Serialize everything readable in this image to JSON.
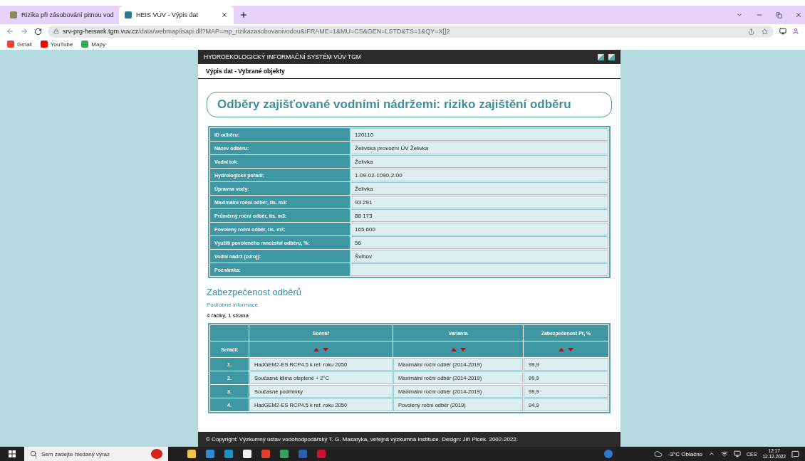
{
  "browser": {
    "tabs": [
      {
        "title": "Rizika při zásobování pitnou vod",
        "selected": false
      },
      {
        "title": "HEIS VÚV - Výpis dat",
        "selected": true
      }
    ],
    "url_host": "srv-prg-heiswrk.tgm.vuv.cz",
    "url_path": "/data/webmap/isapi.dll?MAP=mp_rizikazasobovanivodou&IFRAME=1&MU=CS&GEN=LSTD&TS=1&QY=X[]2",
    "bookmarks": [
      "Gmail",
      "YouTube",
      "Mapy"
    ]
  },
  "page": {
    "header": "HYDROEKOLOGICKÝ INFORMAČNÍ SYSTÉM VÚV TGM",
    "subtitle": "Výpis dat - Vybrané objekty",
    "title": "Odběry zajišťované vodními nádržemi: riziko zajištění odběru",
    "details": [
      {
        "label": "ID odběru:",
        "value": "120110"
      },
      {
        "label": "Název odběru:",
        "value": "Želivská provozní ÚV Želivka"
      },
      {
        "label": "Vodní tok:",
        "value": "Želivka"
      },
      {
        "label": "Hydrologické pořadí:",
        "value": "1-09-02-1090-2-00"
      },
      {
        "label": "Úpravna vody:",
        "value": "Želivka"
      },
      {
        "label": "Maximální roční odběr, tis. m3:",
        "value": "93 291"
      },
      {
        "label": "Průměrný roční odběr, tis. m3:",
        "value": "88 173"
      },
      {
        "label": "Povolený roční odběr, tis. m3:",
        "value": "165 600"
      },
      {
        "label": "Využití povoleného množství odběru, %:",
        "value": "56"
      },
      {
        "label": "Vodní nádrž (zdroj):",
        "value": "Švihov"
      },
      {
        "label": "Poznámka:"
      }
    ],
    "section_title": "Zabezpečenost odběrů",
    "details_link": "Podrobné informace",
    "count": "4 řádky, 1 strana",
    "table": {
      "sort_label": "Seřadit",
      "columns": [
        "Scénář",
        "Varianta",
        "Zabezpečenost Pt, %"
      ],
      "rows": [
        {
          "index": "1.",
          "cells": [
            "HadGEM2-ES RCP4.5 k ref. roku 2050",
            "Maximální roční odběr (2014-2019)",
            "99,9"
          ]
        },
        {
          "index": "2.",
          "cells": [
            "Současné klima oteplené + 2°C",
            "Maximální roční odběr (2014-2019)",
            "99,9"
          ]
        },
        {
          "index": "3.",
          "cells": [
            "Současné podmínky",
            "Maximální roční odběr (2014-2019)",
            "99,9"
          ]
        },
        {
          "index": "4.",
          "cells": [
            "HadGEM2-ES RCP4.5 k ref. roku 2050",
            "Povolený roční odběr (2019)",
            "94,9"
          ]
        }
      ]
    },
    "footer": "© Copyright: Výzkumný ústav vodohodpodářský T. G. Masaryka, veřejná výzkumná instituce. Design: Jiří Picek. 2002-2022."
  },
  "taskbar": {
    "search_placeholder": "Sem zadejte hledaný výraz",
    "weather": "-3°C Oblačno",
    "language": "CES",
    "time": "12:17",
    "date": "12.12.2022"
  }
}
